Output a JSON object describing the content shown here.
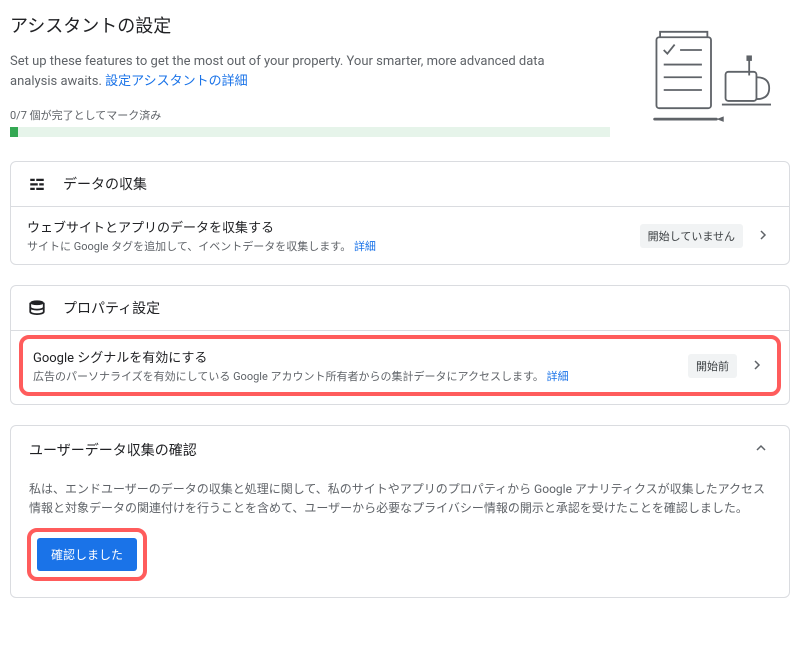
{
  "page": {
    "title": "アシスタントの設定",
    "intro_text": "Set up these features to get the most out of your property. Your smarter, more advanced data analysis awaits. ",
    "intro_link": "設定アシスタントの詳細"
  },
  "progress": {
    "label": "0/7 個が完了としてマーク済み"
  },
  "sections": {
    "data_collection": {
      "title": "データの収集",
      "item": {
        "title": "ウェブサイトとアプリのデータを収集する",
        "desc": "サイトに Google タグを追加して、イベントデータを収集します。 ",
        "detail_link": "詳細",
        "status": "開始していません"
      }
    },
    "property_settings": {
      "title": "プロパティ設定",
      "item": {
        "title": "Google シグナルを有効にする",
        "desc": "広告のパーソナライズを有効にしている Google アカウント所有者からの集計データにアクセスします。 ",
        "detail_link": "詳細",
        "status": "開始前"
      }
    },
    "user_data_ack": {
      "title": "ユーザーデータ収集の確認",
      "body": "私は、エンドユーザーのデータの収集と処理に関して、私のサイトやアプリのプロパティから Google アナリティクスが収集したアクセス情報と対象データの関連付けを行うことを含めて、ユーザーから必要なプライバシー情報の開示と承認を受けたことを確認しました。",
      "button": "確認しました"
    }
  }
}
